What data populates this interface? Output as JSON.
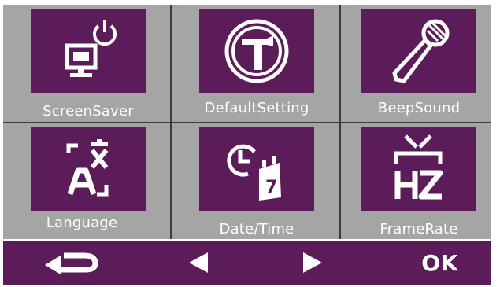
{
  "menu": {
    "items": [
      {
        "label": "ScreenSaver",
        "icon": "monitor-power-icon"
      },
      {
        "label": "DefaultSetting",
        "icon": "hammer-icon"
      },
      {
        "label": "BeepSound",
        "icon": "microphone-icon"
      },
      {
        "label": "Language",
        "icon": "language-icon"
      },
      {
        "label": "Date/Time",
        "icon": "clock-calendar-icon"
      },
      {
        "label": "FrameRate",
        "icon": "tv-hz-icon"
      }
    ]
  },
  "bottom_bar": {
    "back_icon": "return-arrow-icon",
    "prev_icon": "left-triangle-icon",
    "next_icon": "right-triangle-icon",
    "ok_label": "OK"
  },
  "colors": {
    "accent_purple": "#5b1c59",
    "panel_gray": "#a5a5a5",
    "divider": "#3c3c3c",
    "foreground": "#ffffff"
  }
}
